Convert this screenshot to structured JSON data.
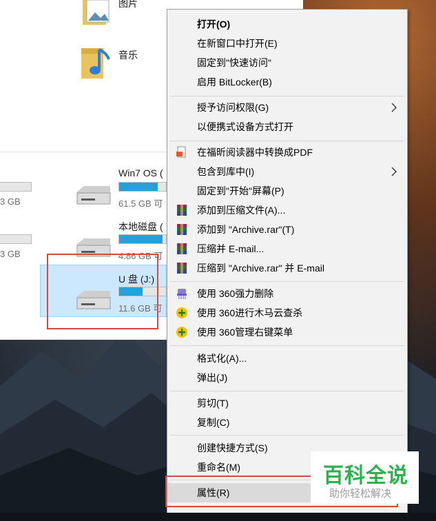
{
  "explorer": {
    "folders": [
      {
        "label": "图片",
        "icon": "pictures-folder-icon"
      },
      {
        "label": "音乐",
        "icon": "music-folder-icon"
      }
    ],
    "left_partial_drives": [
      {
        "free": "3 GB"
      },
      {
        "free": "3 GB"
      }
    ],
    "drives": [
      {
        "name": "Win7 OS (",
        "free": "61.5 GB 可",
        "used_fraction": 0.82
      },
      {
        "name": "本地磁盘 (",
        "free": "4.86 GB 可",
        "used_fraction": 0.93
      },
      {
        "name": "U 盘 (J:)",
        "free": "11.6 GB 可",
        "used_fraction": 0.5,
        "selected": true
      }
    ]
  },
  "context_menu": {
    "groups": [
      [
        {
          "label": "打开(O)",
          "bold": true
        },
        {
          "label": "在新窗口中打开(E)"
        },
        {
          "label": "固定到\"快速访问\""
        },
        {
          "label": "启用 BitLocker(B)"
        }
      ],
      [
        {
          "label": "授予访问权限(G)",
          "submenu": true
        },
        {
          "label": "以便携式设备方式打开"
        }
      ],
      [
        {
          "label": "在福昕阅读器中转换成PDF",
          "icon": "foxit-pdf-icon"
        },
        {
          "label": "包含到库中(I)",
          "submenu": true
        },
        {
          "label": "固定到\"开始\"屏幕(P)"
        },
        {
          "label": "添加到压缩文件(A)...",
          "icon": "winrar-icon"
        },
        {
          "label": "添加到 \"Archive.rar\"(T)",
          "icon": "winrar-icon"
        },
        {
          "label": "压缩并 E-mail...",
          "icon": "winrar-icon"
        },
        {
          "label": "压缩到 \"Archive.rar\" 并 E-mail",
          "icon": "winrar-icon"
        }
      ],
      [
        {
          "label": "使用 360强力删除",
          "icon": "shredder-360-icon"
        },
        {
          "label": "使用 360进行木马云查杀",
          "icon": "plus-360-icon"
        },
        {
          "label": "使用 360管理右键菜单",
          "icon": "plus-360-icon"
        }
      ],
      [
        {
          "label": "格式化(A)..."
        },
        {
          "label": "弹出(J)"
        }
      ],
      [
        {
          "label": "剪切(T)"
        },
        {
          "label": "复制(C)"
        }
      ],
      [
        {
          "label": "创建快捷方式(S)"
        },
        {
          "label": "重命名(M)"
        }
      ],
      [
        {
          "label": "属性(R)",
          "hovered": true
        }
      ]
    ]
  },
  "watermark": {
    "title": "百科全说",
    "subtitle": "助你轻松解决"
  },
  "colors": {
    "accent_highlight": "#d9463a",
    "selection": "#cce8ff",
    "drive_bar": "#26a0da",
    "watermark_green": "#2bb24c"
  }
}
